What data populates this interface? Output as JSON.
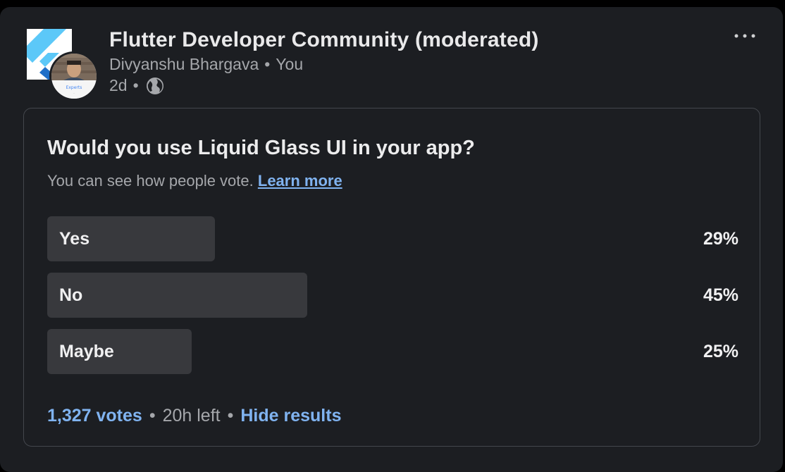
{
  "header": {
    "group_name": "Flutter Developer Community (moderated)",
    "author": "Divyanshu Bhargava",
    "author_relation": "You",
    "separator": "•",
    "age": "2d",
    "visibility_icon": "globe-icon",
    "more_icon": "more-horizontal-icon",
    "avatar_badge": "Experts"
  },
  "poll": {
    "question": "Would you use Liquid Glass UI in your app?",
    "subtitle": "You can see how people vote.",
    "learn_more": "Learn more",
    "options": [
      {
        "label": "Yes",
        "percent_text": "29%",
        "percent": 29
      },
      {
        "label": "No",
        "percent_text": "45%",
        "percent": 45
      },
      {
        "label": "Maybe",
        "percent_text": "25%",
        "percent": 25
      }
    ],
    "votes": "1,327 votes",
    "time_left": "20h left",
    "hide_results": "Hide results",
    "separator": "•"
  },
  "colors": {
    "background": "#1c1e22",
    "bar": "#38393d",
    "link": "#80b3f0",
    "muted_text": "#a5a7ab"
  }
}
